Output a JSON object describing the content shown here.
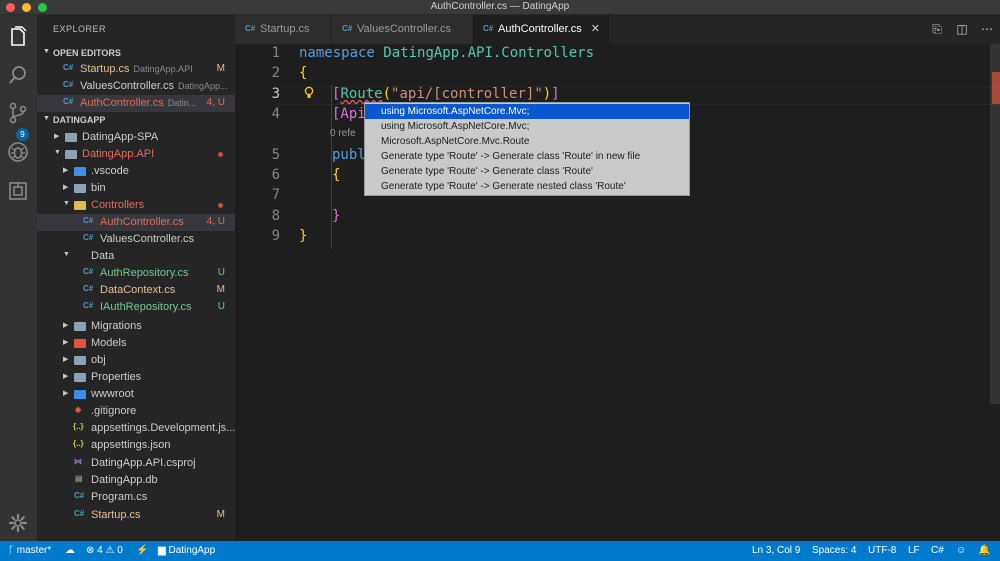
{
  "window": {
    "title": "AuthController.cs — DatingApp"
  },
  "activity": {
    "scm_badge": "9"
  },
  "sidebar": {
    "title": "EXPLORER",
    "open_editors_label": "OPEN EDITORS",
    "open_editors": [
      {
        "name": "Startup.cs",
        "path": "DatingApp.API",
        "status": "M"
      },
      {
        "name": "ValuesController.cs",
        "path": "DatingApp...",
        "status": ""
      },
      {
        "name": "AuthController.cs",
        "path": "Datin...",
        "status": "4, U"
      }
    ],
    "project_label": "DATINGAPP",
    "tree": [
      {
        "name": "DatingApp-SPA",
        "status": ""
      },
      {
        "name": "DatingApp.API",
        "status": ""
      },
      {
        "name": ".vscode",
        "status": ""
      },
      {
        "name": "bin",
        "status": ""
      },
      {
        "name": "Controllers",
        "status": ""
      },
      {
        "name": "AuthController.cs",
        "status": "4, U"
      },
      {
        "name": "ValuesController.cs",
        "status": ""
      },
      {
        "name": "Data",
        "status": ""
      },
      {
        "name": "AuthRepository.cs",
        "status": "U"
      },
      {
        "name": "DataContext.cs",
        "status": "M"
      },
      {
        "name": "IAuthRepository.cs",
        "status": "U"
      },
      {
        "name": "Migrations",
        "status": ""
      },
      {
        "name": "Models",
        "status": ""
      },
      {
        "name": "obj",
        "status": ""
      },
      {
        "name": "Properties",
        "status": ""
      },
      {
        "name": "wwwroot",
        "status": ""
      },
      {
        "name": ".gitignore",
        "status": ""
      },
      {
        "name": "appsettings.Development.js...",
        "status": ""
      },
      {
        "name": "appsettings.json",
        "status": ""
      },
      {
        "name": "DatingApp.API.csproj",
        "status": ""
      },
      {
        "name": "DatingApp.db",
        "status": ""
      },
      {
        "name": "Program.cs",
        "status": ""
      },
      {
        "name": "Startup.cs",
        "status": "M"
      }
    ]
  },
  "tabs": [
    {
      "label": "Startup.cs"
    },
    {
      "label": "ValuesController.cs"
    },
    {
      "label": "AuthController.cs"
    }
  ],
  "editor": {
    "line_numbers": [
      "1",
      "2",
      "3",
      "4",
      "5",
      "6",
      "7",
      "8",
      "9"
    ],
    "code": {
      "namespace_kw": "namespace",
      "namespace_name": "DatingApp.API.Controllers",
      "open_brace": "{",
      "route_open": "[",
      "route_attr": "Route",
      "route_paren_open": "(",
      "route_string": "\"api/[controller]\"",
      "route_paren_close": ")",
      "route_close": "]",
      "api_attr_partial": "[Api",
      "codelens": "0 refe",
      "public_partial": "publ",
      "inner_open": "{",
      "inner_close": "}",
      "close_brace": "}"
    },
    "suggestions": [
      "using Microsoft.AspNetCore.Mvc;",
      "using Microsoft.AspNetCore.Mvc;",
      "Microsoft.AspNetCore.Mvc.Route",
      "Generate type 'Route' -> Generate class 'Route' in new file",
      "Generate type 'Route' -> Generate class 'Route'",
      "Generate type 'Route' -> Generate nested class 'Route'"
    ]
  },
  "status": {
    "branch": "master*",
    "errors": "4",
    "warnings": "0",
    "project": "DatingApp",
    "position": "Ln 3, Col 9",
    "spaces": "Spaces: 4",
    "encoding": "UTF-8",
    "eol": "LF",
    "language": "C#"
  },
  "colors": {
    "accent": "#007acc",
    "modified": "#e2c08d",
    "untracked": "#73c991",
    "error": "#e06c5d",
    "selection": "#0a57d0"
  }
}
